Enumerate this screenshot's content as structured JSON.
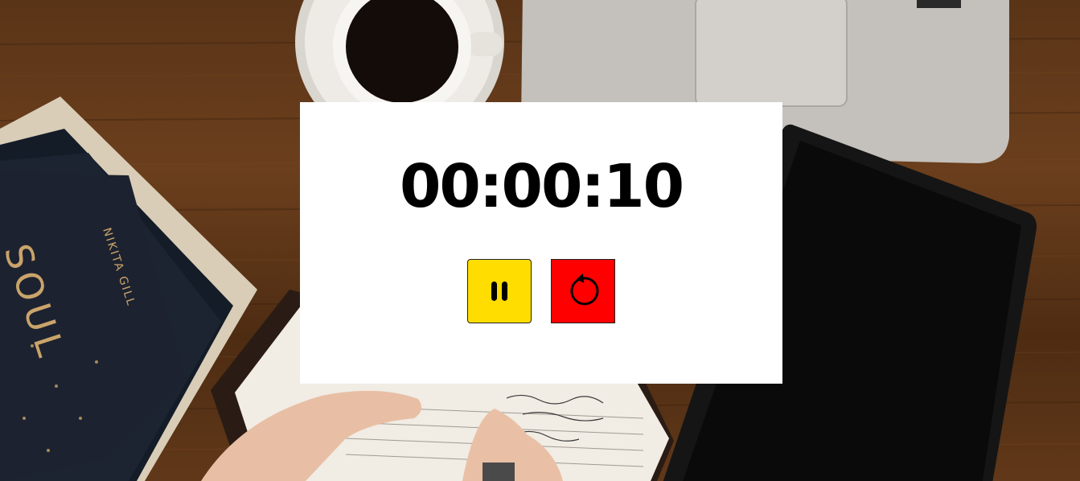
{
  "timer": {
    "display": "00:00:10"
  },
  "controls": {
    "pause": {
      "icon": "pause-icon",
      "color": "#ffdd00"
    },
    "reset": {
      "icon": "reset-icon",
      "color": "#ff0000"
    }
  }
}
